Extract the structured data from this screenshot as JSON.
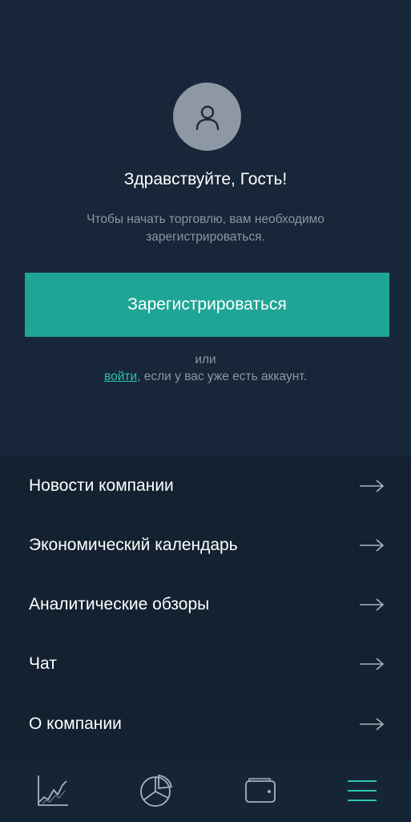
{
  "header": {
    "greeting": "Здравствуйте, Гость!",
    "subtitle": "Чтобы начать торговлю, вам необходимо зарегистрироваться.",
    "avatar_icon": "user-icon"
  },
  "actions": {
    "register_label": "Зарегистрироваться",
    "or_label": "или",
    "login_link": "войти",
    "login_suffix": ", если у вас уже есть аккаунт."
  },
  "menu": {
    "items": [
      {
        "label": "Новости компании",
        "icon": "arrow-right-icon"
      },
      {
        "label": "Экономический календарь",
        "icon": "arrow-right-icon"
      },
      {
        "label": "Аналитические обзоры",
        "icon": "arrow-right-icon"
      },
      {
        "label": "Чат",
        "icon": "arrow-right-icon"
      },
      {
        "label": "О компании",
        "icon": "arrow-right-icon"
      }
    ]
  },
  "bottom_nav": {
    "items": [
      {
        "icon": "line-chart-icon",
        "active": false
      },
      {
        "icon": "pie-chart-icon",
        "active": false
      },
      {
        "icon": "wallet-icon",
        "active": false
      },
      {
        "icon": "hamburger-menu-icon",
        "active": true
      }
    ]
  },
  "colors": {
    "background": "#162536",
    "accent": "#1fa595",
    "link": "#2ec4b2",
    "muted_text": "#8b96a3",
    "avatar_bg": "#8e98a4"
  }
}
